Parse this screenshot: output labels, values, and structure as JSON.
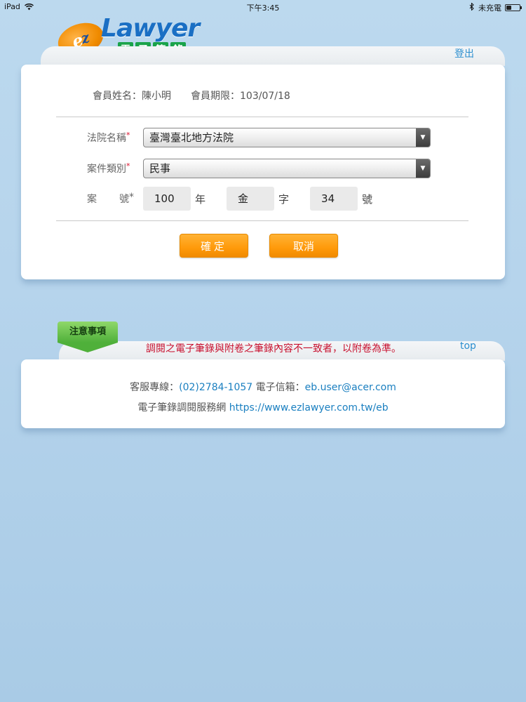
{
  "status_bar": {
    "device": "iPad",
    "time": "下午3:45",
    "charging": "未充電",
    "battery_level": 0.4
  },
  "header": {
    "logo_prefix": "e",
    "logo_z": "z",
    "logo_word": "Lawyer",
    "logo_cn": [
      "電",
      "子",
      "筆",
      "錄"
    ],
    "logout": "登出"
  },
  "member": {
    "name_label": "會員姓名：",
    "name": "陳小明",
    "expiry_label": "會員期限：",
    "expiry": "103/07/18"
  },
  "form": {
    "court_label": "法院名稱",
    "court_value": "臺灣臺北地方法院",
    "category_label": "案件類別",
    "category_value": "民事",
    "case_label_a": "案",
    "case_label_b": "號",
    "required_mark": "*",
    "year_value": "100",
    "year_unit": "年",
    "word_value": "金",
    "word_unit": "字",
    "number_value": "34",
    "number_unit": "號",
    "ok_label": "確定",
    "cancel_label": "取消"
  },
  "notice": {
    "tab_label": "注意事項",
    "text": "調閱之電子筆錄與附卷之筆錄內容不一致者，以附卷為準。",
    "top_link": "top"
  },
  "contact": {
    "phone_label": "客服專線：",
    "phone": "(02)2784-1057",
    "email_label": " 電子信箱：",
    "email": "eb.user@acer.com",
    "site_label": "電子筆錄調閱服務網 ",
    "site": "https://www.ezlawyer.com.tw/eb"
  }
}
